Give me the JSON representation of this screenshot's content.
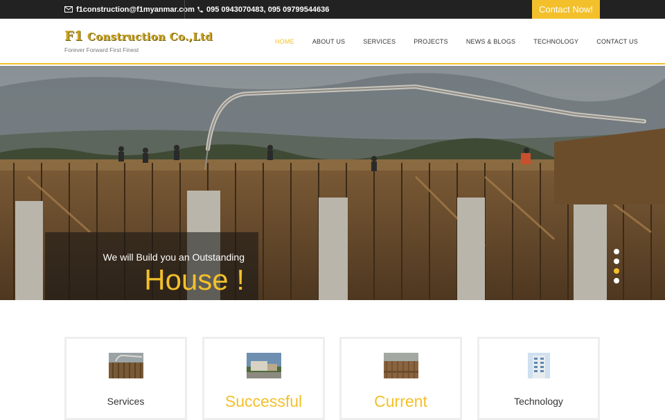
{
  "topbar": {
    "email": "f1construction@f1myanmar.com",
    "phone": "095 0943070483, 095 09799544636",
    "cta_label": "Contact Now!"
  },
  "logo": {
    "brand_prefix": "F1",
    "brand_rest": "Construction Co.,Ltd",
    "tagline": "Forever Forward First Finest"
  },
  "nav": {
    "items": [
      {
        "label": "HOME"
      },
      {
        "label": "ABOUT US"
      },
      {
        "label": "SERVICES"
      },
      {
        "label": "PROJECTS"
      },
      {
        "label": "NEWS & BLOGS"
      },
      {
        "label": "TECHNOLOGY"
      },
      {
        "label": "CONTACT US"
      }
    ]
  },
  "hero": {
    "subtitle": "We will Build you an Outstanding",
    "headline": "House !"
  },
  "cards": [
    {
      "title": "Services"
    },
    {
      "title": "Successful"
    },
    {
      "title": "Current"
    },
    {
      "title": "Technology"
    }
  ],
  "colors": {
    "accent": "#f3c02b",
    "topbar": "#222222",
    "text": "#333333"
  }
}
